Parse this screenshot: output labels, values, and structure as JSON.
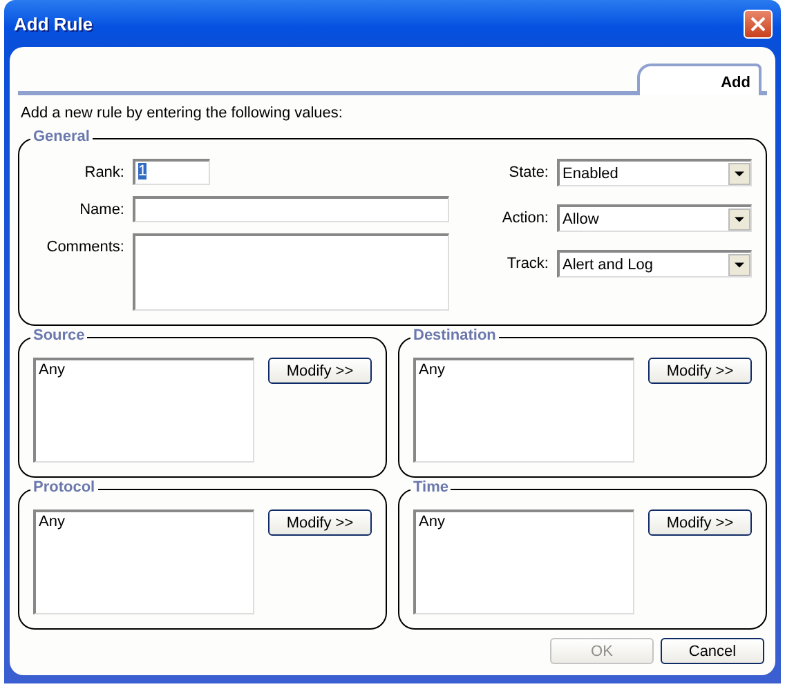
{
  "window": {
    "title": "Add Rule"
  },
  "tabs": [
    {
      "label": "Add",
      "selected": true
    }
  ],
  "intro": "Add a new rule by entering the following values:",
  "general": {
    "title": "General",
    "fields": [
      {
        "label": "Rank:",
        "value": "1",
        "kind": "short",
        "highlighted": true
      },
      {
        "label": "Name:",
        "kind": "text"
      },
      {
        "label": "Comments:",
        "kind": "multiline"
      }
    ],
    "dropdowns": [
      {
        "label": "State:",
        "value": "Enabled"
      },
      {
        "label": "Action:",
        "value": "Allow"
      },
      {
        "label": "Track:",
        "value": "Alert and Log"
      }
    ]
  },
  "groups": [
    {
      "title": "Source",
      "items": [
        "Any"
      ],
      "button": "Modify >>"
    },
    {
      "title": "Destination",
      "items": [
        "Any"
      ],
      "button": "Modify >>"
    },
    {
      "title": "Protocol",
      "items": [
        "Any"
      ],
      "button": "Modify >>"
    },
    {
      "title": "Time",
      "items": [
        "Any"
      ],
      "button": "Modify >>"
    }
  ],
  "buttons": [
    {
      "label": "OK",
      "disabled": true
    },
    {
      "label": "Cancel",
      "disabled": false
    }
  ]
}
